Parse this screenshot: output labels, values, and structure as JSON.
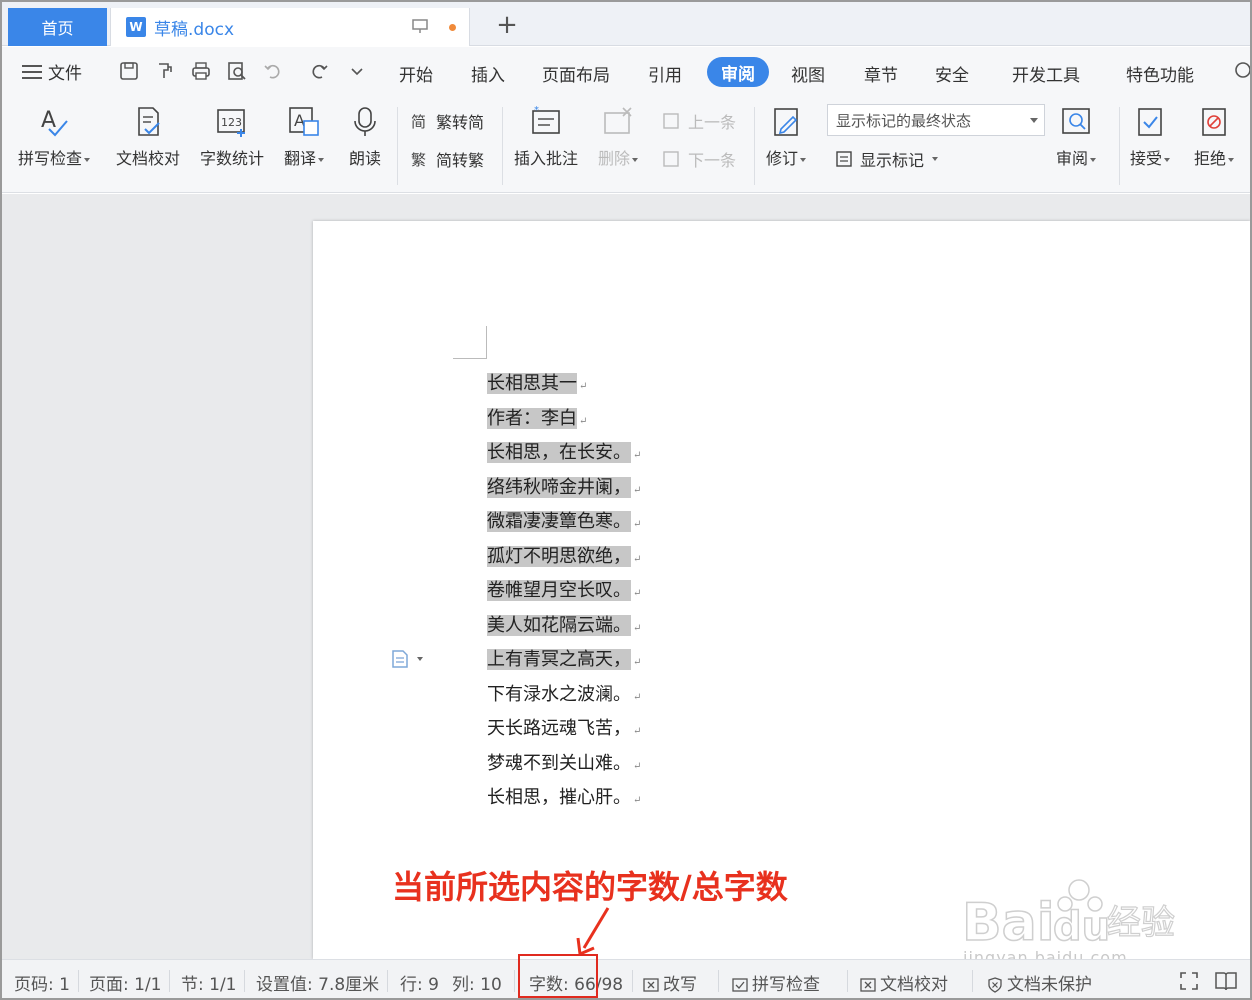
{
  "tabs": {
    "home": "首页",
    "doc_icon": "W",
    "doc_title": "草稿.docx",
    "add": "+"
  },
  "menu": {
    "file": "文件",
    "items": [
      "开始",
      "插入",
      "页面布局",
      "引用",
      "审阅",
      "视图",
      "章节",
      "安全",
      "开发工具",
      "特色功能"
    ],
    "active": "审阅"
  },
  "ribbon": {
    "spell_check": "拼写检查",
    "doc_proof": "文档校对",
    "word_count": "字数统计",
    "translate": "翻译",
    "read_aloud": "朗读",
    "trad_to_simp": "繁转简",
    "simp_to_trad": "简转繁",
    "insert_comment": "插入批注",
    "delete": "删除",
    "prev": "上一条",
    "next": "下一条",
    "revise": "修订",
    "markup_combo": "显示标记的最终状态",
    "show_markup": "显示标记",
    "review": "审阅",
    "accept": "接受",
    "reject": "拒绝"
  },
  "document": {
    "lines": [
      "长相思其一",
      "作者：李白",
      "长相思，在长安。",
      "络纬秋啼金井阑，",
      "微霜凄凄簟色寒。",
      "孤灯不明思欲绝，",
      "卷帷望月空长叹。",
      "美人如花隔云端。",
      "上有青冥之高天，",
      "下有渌水之波澜。",
      "天长路远魂飞苦，",
      "梦魂不到关山难。",
      "长相思，摧心肝。"
    ],
    "selected_count": 9
  },
  "annotation": {
    "text": "当前所选内容的字数/总字数"
  },
  "watermark": {
    "text": "jingyan.baidu.com"
  },
  "status": {
    "page_code": "页码: 1",
    "page": "页面: 1/1",
    "section": "节: 1/1",
    "setting": "设置值: 7.8厘米",
    "row": "行: 9",
    "col": "列: 10",
    "word_count": "字数: 66/98",
    "overwrite": "改写",
    "spell": "拼写检查",
    "proof": "文档校对",
    "protect": "文档未保护"
  },
  "colors": {
    "accent": "#3a86e8",
    "selection": "#c7c7c7",
    "annotation": "#e8311e"
  }
}
